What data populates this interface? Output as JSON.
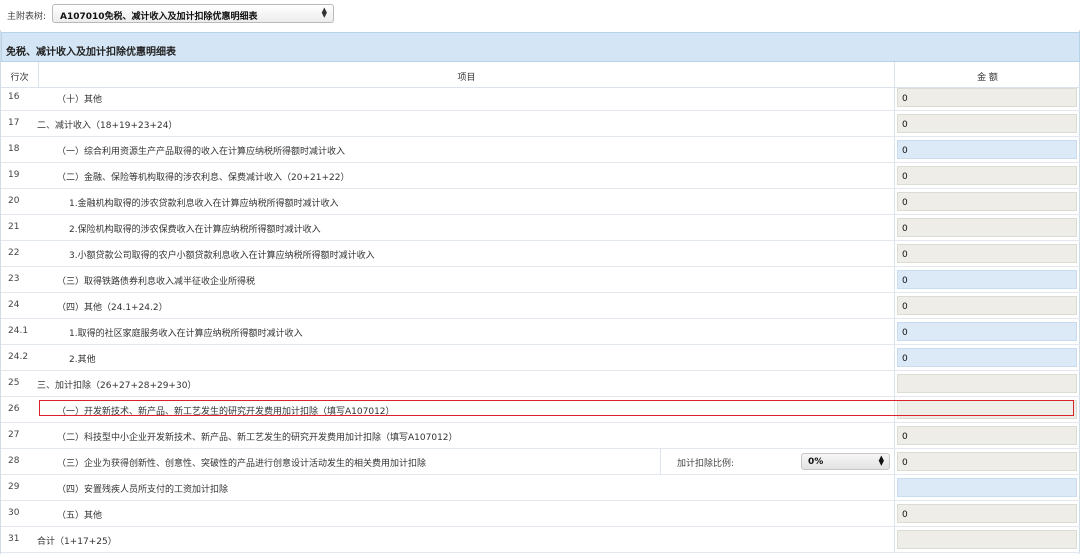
{
  "header": {
    "main_table_label": "主附表树:",
    "main_table_selected": "A107010免税、减计收入及加计扣除优惠明细表"
  },
  "table": {
    "title": "免税、减计收入及加计扣除优惠明细表",
    "col_row_no": "行次",
    "col_item": "项目",
    "col_amount": "金 额",
    "rows": [
      {
        "no": "16",
        "label": "（十）其他",
        "amount": "0"
      },
      {
        "no": "17",
        "label": "二、减计收入（18+19+23+24）",
        "amount": "0"
      },
      {
        "no": "18",
        "label": "（一）综合利用资源生产产品取得的收入在计算应纳税所得额时减计收入",
        "amount": "0"
      },
      {
        "no": "19",
        "label": "（二）金融、保险等机构取得的涉农利息、保费减计收入（20+21+22）",
        "amount": "0"
      },
      {
        "no": "20",
        "label": "1.金融机构取得的涉农贷款利息收入在计算应纳税所得额时减计收入",
        "amount": "0"
      },
      {
        "no": "21",
        "label": "2.保险机构取得的涉农保费收入在计算应纳税所得额时减计收入",
        "amount": "0"
      },
      {
        "no": "22",
        "label": "3.小额贷款公司取得的农户小额贷款利息收入在计算应纳税所得额时减计收入",
        "amount": "0"
      },
      {
        "no": "23",
        "label": "（三）取得铁路债券利息收入减半征收企业所得税",
        "amount": "0"
      },
      {
        "no": "24",
        "label": "（四）其他（24.1+24.2）",
        "amount": "0"
      },
      {
        "no": "24.1",
        "label": "1.取得的社区家庭服务收入在计算应纳税所得额时减计收入",
        "amount": "0"
      },
      {
        "no": "24.2",
        "label": "2.其他",
        "amount": "0"
      },
      {
        "no": "25",
        "label": "三、加计扣除（26+27+28+29+30）",
        "amount": ""
      },
      {
        "no": "26",
        "label": "（一）开发新技术、新产品、新工艺发生的研究开发费用加计扣除（填写A107012）",
        "amount": ""
      },
      {
        "no": "27",
        "label": "（二）科技型中小企业开发新技术、新产品、新工艺发生的研究开发费用加计扣除（填写A107012）",
        "amount": "0"
      },
      {
        "no": "28",
        "label": "（三）企业为获得创新性、创意性、突破性的产品进行创意设计活动发生的相关费用加计扣除",
        "amount": "0",
        "ratio_label": "加计扣除比例:",
        "ratio_value": "0%"
      },
      {
        "no": "29",
        "label": "（四）安置残疾人员所支付的工资加计扣除",
        "amount": ""
      },
      {
        "no": "30",
        "label": "（五）其他",
        "amount": "0"
      },
      {
        "no": "31",
        "label": "合计（1+17+25）",
        "amount": ""
      }
    ]
  },
  "colors": {
    "title_bg": "#d4e6f5",
    "editable_cell": "#dce9f7",
    "readonly_cell": "#eeede7",
    "highlight_border": "#d8232a"
  }
}
